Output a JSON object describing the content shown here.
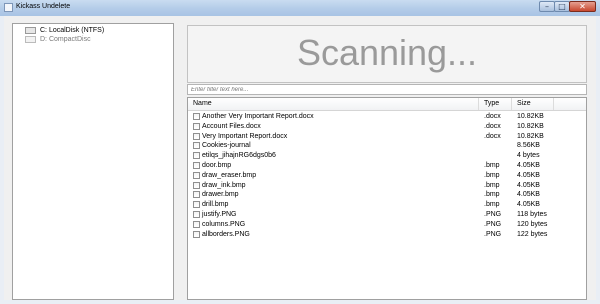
{
  "window": {
    "title": "Kickass Undelete",
    "buttons": {
      "minimize": "–",
      "maximize": "□",
      "close": "✕"
    }
  },
  "drives": [
    {
      "label": "C: LocalDisk (NTFS)",
      "state": "selected"
    },
    {
      "label": "D: CompactDisc",
      "state": "disabled"
    }
  ],
  "scan": {
    "status": "Scanning..."
  },
  "filter": {
    "placeholder": "Enter filter text here..."
  },
  "file_list": {
    "columns": {
      "name": "Name",
      "type": "Type",
      "size": "Size"
    },
    "rows": [
      {
        "name": "Another Very Important Report.docx",
        "type": ".docx",
        "size": "10.82KB"
      },
      {
        "name": "Account Files.docx",
        "type": ".docx",
        "size": "10.82KB"
      },
      {
        "name": "Very Important Report.docx",
        "type": ".docx",
        "size": "10.82KB"
      },
      {
        "name": "Cookies-journal",
        "type": "",
        "size": "8.56KB"
      },
      {
        "name": "etilqs_jihajnRG6dgs0b6",
        "type": "",
        "size": "4 bytes"
      },
      {
        "name": "door.bmp",
        "type": ".bmp",
        "size": "4.05KB"
      },
      {
        "name": "draw_eraser.bmp",
        "type": ".bmp",
        "size": "4.05KB"
      },
      {
        "name": "draw_ink.bmp",
        "type": ".bmp",
        "size": "4.05KB"
      },
      {
        "name": "drawer.bmp",
        "type": ".bmp",
        "size": "4.05KB"
      },
      {
        "name": "drill.bmp",
        "type": ".bmp",
        "size": "4.05KB"
      },
      {
        "name": "justify.PNG",
        "type": ".PNG",
        "size": "118 bytes"
      },
      {
        "name": "columns.PNG",
        "type": ".PNG",
        "size": "120 bytes"
      },
      {
        "name": "allborders.PNG",
        "type": ".PNG",
        "size": "122 bytes"
      }
    ]
  }
}
